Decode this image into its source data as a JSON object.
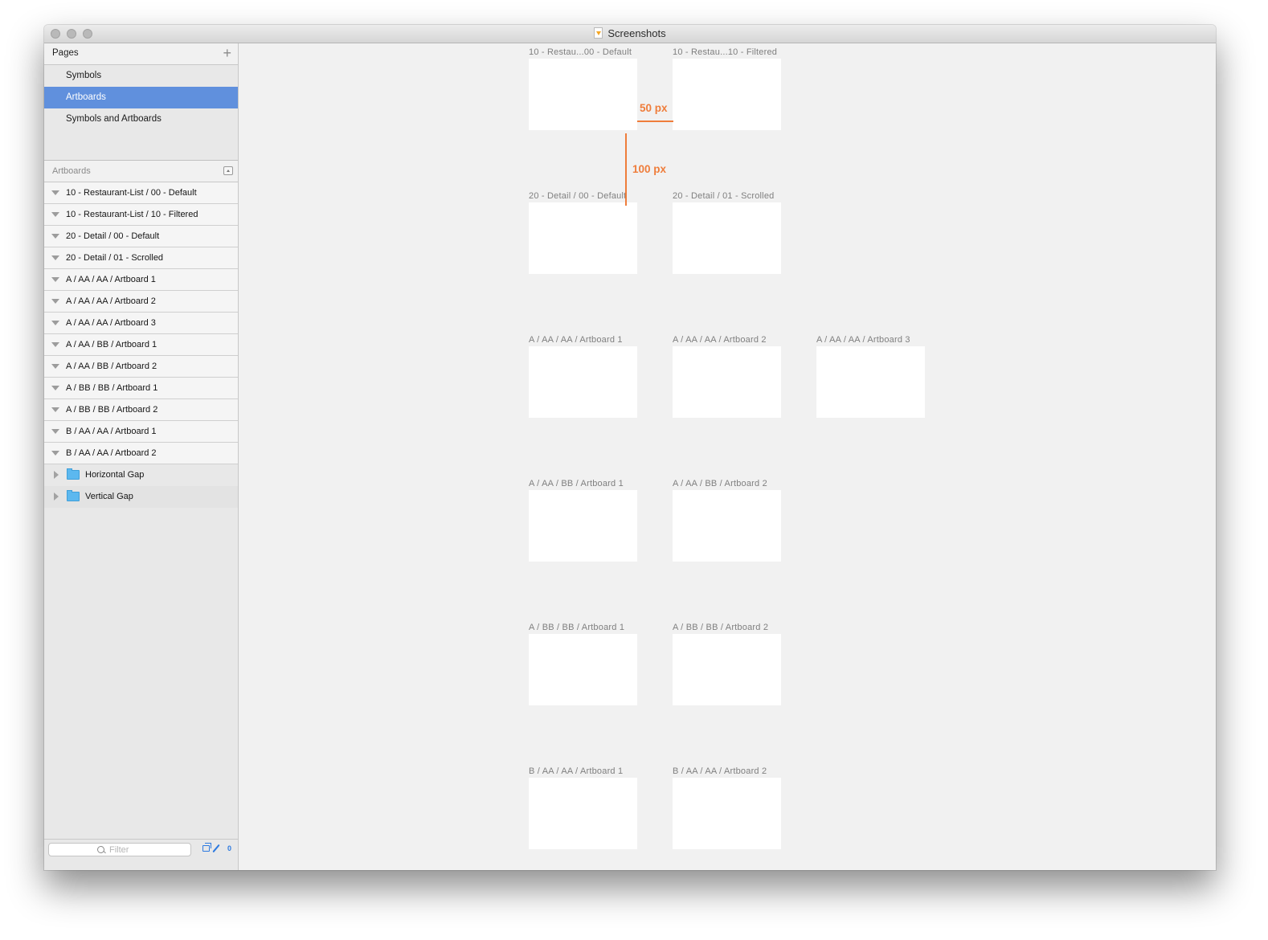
{
  "window": {
    "title": "Screenshots",
    "document_icon": "sketch-document-icon"
  },
  "sidebar": {
    "pages_header": "Pages",
    "add_page_icon": "plus-icon",
    "pages": [
      {
        "label": "Symbols",
        "selected": false
      },
      {
        "label": "Artboards",
        "selected": true
      },
      {
        "label": "Symbols and Artboards",
        "selected": false
      }
    ],
    "layers_header": "Artboards",
    "layers": [
      "10 - Restaurant-List / 00 - Default",
      "10 - Restaurant-List / 10 - Filtered",
      "20 - Detail / 00 - Default",
      "20 - Detail / 01 - Scrolled",
      "A / AA / AA / Artboard 1",
      "A / AA / AA / Artboard 2",
      "A / AA / AA / Artboard 3",
      "A / AA / BB / Artboard 1",
      "A / AA / BB / Artboard 2",
      "A / BB / BB / Artboard 1",
      "A / BB / BB / Artboard 2",
      "B / AA / AA / Artboard 1",
      "B / AA / AA / Artboard 2"
    ],
    "groups": [
      "Horizontal Gap",
      "Vertical Gap"
    ],
    "filter": {
      "placeholder": "Filter",
      "value": ""
    },
    "slice_count": "0"
  },
  "canvas": {
    "artboards": [
      {
        "name": "10 - Restau...00 - Default",
        "row": 0,
        "col": 0
      },
      {
        "name": "10 - Restau...10 - Filtered",
        "row": 0,
        "col": 1
      },
      {
        "name": "20 - Detail / 00 - Default",
        "row": 1,
        "col": 0
      },
      {
        "name": "20 - Detail / 01 - Scrolled",
        "row": 1,
        "col": 1
      },
      {
        "name": "A / AA / AA / Artboard 1",
        "row": 2,
        "col": 0
      },
      {
        "name": "A / AA / AA / Artboard 2",
        "row": 2,
        "col": 1
      },
      {
        "name": "A / AA / AA / Artboard 3",
        "row": 2,
        "col": 2
      },
      {
        "name": "A / AA / BB / Artboard 1",
        "row": 3,
        "col": 0
      },
      {
        "name": "A / AA / BB / Artboard 2",
        "row": 3,
        "col": 1
      },
      {
        "name": "A / BB / BB / Artboard 1",
        "row": 4,
        "col": 0
      },
      {
        "name": "A / BB / BB / Artboard 2",
        "row": 4,
        "col": 1
      },
      {
        "name": "B / AA / AA / Artboard 1",
        "row": 5,
        "col": 0
      },
      {
        "name": "B / AA / AA / Artboard 2",
        "row": 5,
        "col": 1
      }
    ],
    "measurements": {
      "horizontal_gap": "50 px",
      "vertical_gap": "100 px"
    },
    "accent_color": "#ef7d3b"
  },
  "colors": {
    "selection": "#6090dd",
    "canvas_bg": "#f1f1f1",
    "measure": "#ef7d3b",
    "icon_blue": "#2d7ae0"
  }
}
